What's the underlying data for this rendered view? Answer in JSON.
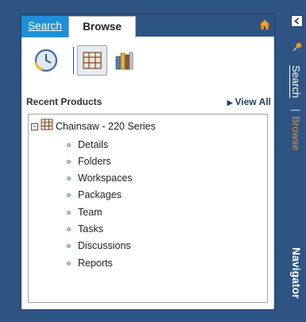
{
  "tabs": {
    "search": "Search",
    "browse": "Browse"
  },
  "section": {
    "title": "Recent Products",
    "view_all": "View All"
  },
  "tree": {
    "root": "Chainsaw - 220 Series",
    "expander": "−",
    "items": [
      "Details",
      "Folders",
      "Workspaces",
      "Packages",
      "Team",
      "Tasks",
      "Discussions",
      "Reports"
    ]
  },
  "side_nav": {
    "search": "Search",
    "separator": "|",
    "browse": "Browse",
    "title": "Navigator"
  },
  "icons": {
    "home": "home-icon",
    "recent": "recent-clock-icon",
    "products": "products-grid-icon",
    "categories": "category-bars-icon",
    "collapse": "collapse-left-icon",
    "pin": "pin-icon"
  },
  "colors": {
    "frame": "#2d5482",
    "active_tab": "#1e90d8",
    "accent": "#e58a34"
  }
}
